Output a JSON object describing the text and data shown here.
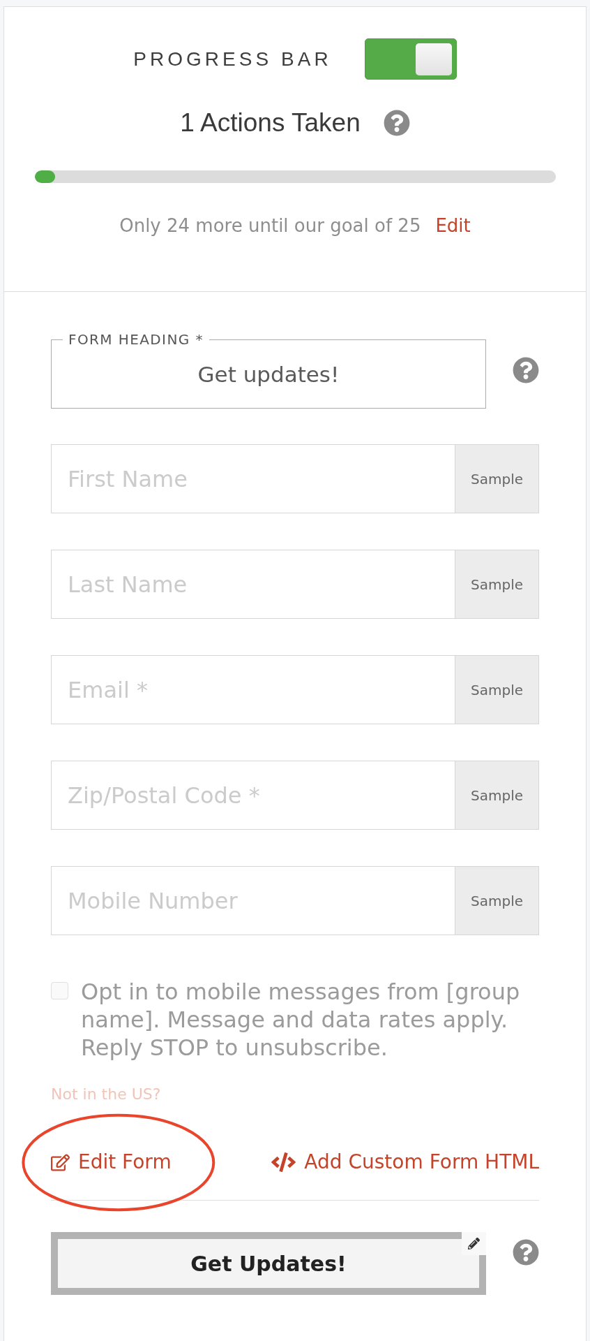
{
  "progress_bar": {
    "title": "PROGRESS BAR",
    "enabled": true,
    "actions_label": "1 Actions Taken",
    "level": 0.04,
    "goal_text": "Only 24 more until our goal of 25",
    "edit_link": "Edit"
  },
  "form": {
    "heading_field": {
      "label": "FORM HEADING *",
      "value": "Get updates!"
    },
    "fields": [
      {
        "placeholder": "First Name",
        "addon": "Sample"
      },
      {
        "placeholder": "Last Name",
        "addon": "Sample"
      },
      {
        "placeholder": "Email *",
        "addon": "Sample"
      },
      {
        "placeholder": "Zip/Postal Code *",
        "addon": "Sample"
      },
      {
        "placeholder": "Mobile Number",
        "addon": "Sample"
      }
    ],
    "opt_in": {
      "checked": false,
      "text": "Opt in to mobile messages from [group name]. Message and data rates apply. Reply STOP to unsubscribe."
    },
    "not_in_us_link": "Not in the US?",
    "links": [
      {
        "kind": "edit",
        "label": "Edit Form",
        "circled": true
      },
      {
        "kind": "code",
        "label": "Add Custom Form HTML",
        "circled": false
      }
    ],
    "submit_button": {
      "label": "Get Updates!"
    }
  }
}
